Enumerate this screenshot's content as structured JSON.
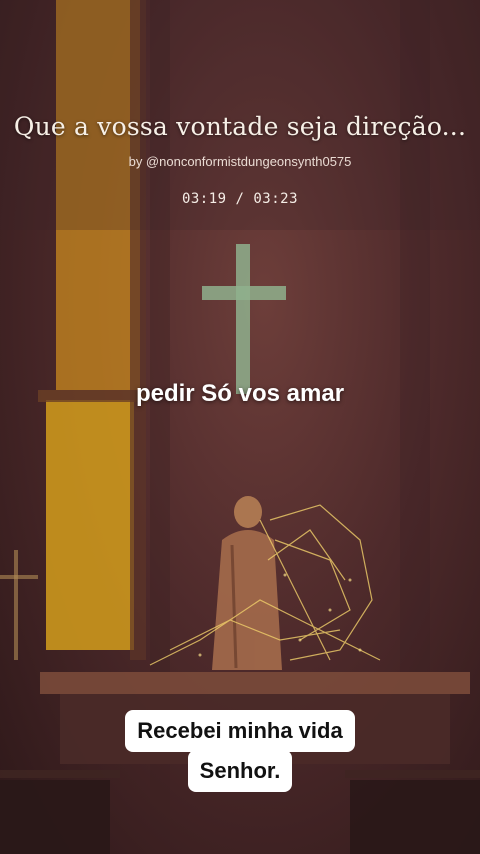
{
  "header": {
    "title": "Que  a vossa vontade seja  direção...",
    "byline": "by @nonconformistdungeonsynth0575",
    "time": "03:19 / 03:23"
  },
  "lyrics": {
    "current": "pedir Só vos amar"
  },
  "caption": {
    "line1": "Recebei minha vida",
    "line2": "Senhor."
  },
  "scene": {
    "window_color": "#e0b21a",
    "cross_color": "#8fb08d",
    "glow_color": "#f0cf6a"
  }
}
